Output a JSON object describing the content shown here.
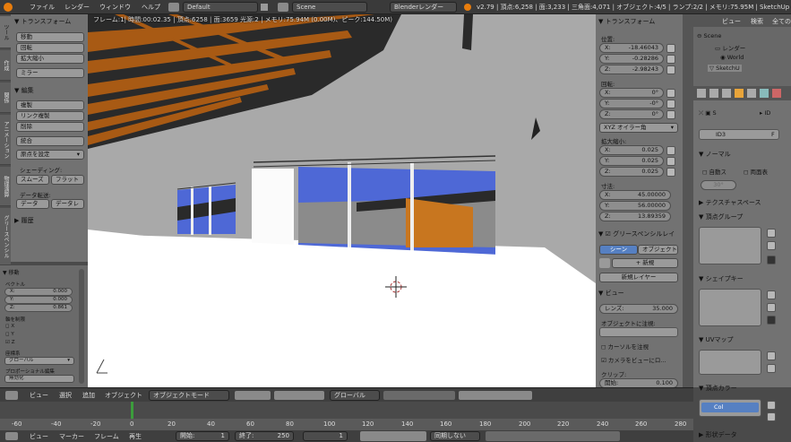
{
  "menu": {
    "items": [
      "ファイル",
      "レンダー",
      "ウィンドウ",
      "ヘルプ"
    ],
    "layout": "Default",
    "scene": "Scene",
    "engine": "Blenderレンダー",
    "stats": "v2.79 | 頂点:6,258 | 面:3,233 | 三角面:4,071 | オブジェクト:4/5 | ランプ:2/2 | メモリ:75.95M | SketchUp"
  },
  "viewport": {
    "info": "フレーム:1| 時間:00:02.35 | 頂点:6258 | 面:3659 光源:2 | メモリ:75.94M (0.00M)、ピーク:144.50M)"
  },
  "tool": {
    "tabs": [
      "ツール",
      "作成",
      "関係",
      "アニメーション",
      "物理演算",
      "グリースペンシル"
    ],
    "transform_header": "トランスフォーム",
    "move": "移動",
    "rotate": "回転",
    "scale": "拡大縮小",
    "mirror": "ミラー",
    "edit_header": "編集",
    "duplicate": "複製",
    "linked_duplicate": "リンク複製",
    "delete": "削除",
    "join": "統合",
    "origin": "原点を設定",
    "shading_label": "シェーディング:",
    "smooth": "スムーズ",
    "flat": "フラット",
    "data_transfer_label": "データ転送:",
    "data": "データ",
    "data_layout": "データレ",
    "history": "履歴",
    "op_header": "移動",
    "vector": "ベクトル",
    "x": "X:",
    "y": "Y:",
    "z": "Z:",
    "vx": "0.000",
    "vy": "0.000",
    "vz": "0.861",
    "constraint": "軸を制限",
    "cx": "X",
    "cy": "Y",
    "cz": "Z",
    "orientation": "座標系",
    "orientation_val": "グローバル",
    "proportional": "プロポーショナル編集",
    "proportional_val": "無効化"
  },
  "props": {
    "transform_header": "トランスフォーム",
    "location": "位置:",
    "lx": "-18.46043",
    "ly": "-0.28286",
    "lz": "-2.98243",
    "rotation": "回転:",
    "rx": "0°",
    "ry": "-0°",
    "rz": "0°",
    "rotmode": "XYZ オイラー角",
    "scale": "拡大縮小:",
    "sx": "0.025",
    "sy": "0.025",
    "sz": "0.025",
    "dimensions": "寸法:",
    "dx": "45.00000",
    "dy": "56.00000",
    "dz": "13.89359",
    "gp_header": "グリースペンシルレイ",
    "gp_scene": "シーン",
    "gp_object": "オブジェクト",
    "gp_new": "新規",
    "gp_new_layer": "新規レイヤー",
    "view_header": "ビュー",
    "lens": "レンズ:",
    "lens_val": "35.000",
    "lock_object": "オブジェクトに注視:",
    "lock_cursor": "カーソルを注視",
    "lock_camera": "カメラをビューにロ...",
    "clip": "クリップ:",
    "clip_start": "開始:",
    "clip_start_val": "0.100"
  },
  "outliner": {
    "view": "ビュー",
    "search": "検索",
    "all": "全ての",
    "scene": "Scene",
    "render": "レンダー",
    "world": "World",
    "sketch": "SketchU"
  },
  "data": {
    "name": "ID3",
    "f": "F",
    "s": "S",
    "id": "ID",
    "normal": "ノーマル",
    "autosmooth": "自動ス",
    "double": "両面表",
    "angle": "30°",
    "texspace": "テクスチャスペース",
    "vgroups": "頂点グループ",
    "shapekeys": "シェイプキー",
    "uvmap": "UVマップ",
    "vcolor": "頂点カラー",
    "col": "Col",
    "shapedata": "形状データ"
  },
  "header3d": {
    "view": "ビュー",
    "select": "選択",
    "add": "追加",
    "object": "オブジェクト",
    "mode": "オブジェクトモード",
    "orient": "グローバル"
  },
  "timeline": {
    "ticks": [
      "-60",
      "-40",
      "-20",
      "0",
      "20",
      "40",
      "60",
      "80",
      "100",
      "120",
      "140",
      "160",
      "180",
      "200",
      "220",
      "240",
      "260",
      "280"
    ],
    "view": "ビュー",
    "marker": "マーカー",
    "frame": "フレーム",
    "play": "再生",
    "start_label": "開始:",
    "start": "1",
    "end_label": "終了:",
    "end": "250",
    "current": "1",
    "sync": "同期しない"
  }
}
